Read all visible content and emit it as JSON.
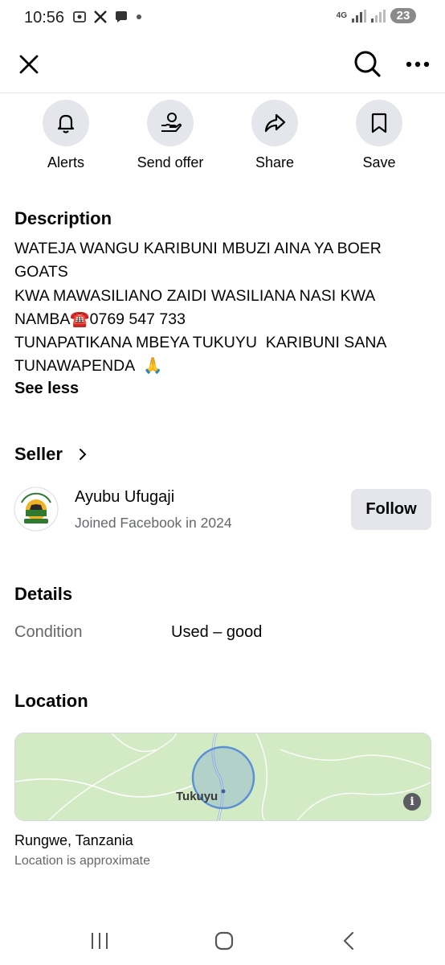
{
  "status_bar": {
    "time": "10:56",
    "network": "4G",
    "battery": "23",
    "icons": [
      "screenshot-icon",
      "x-app-icon",
      "chat-icon",
      "dot-icon"
    ]
  },
  "top_bar": {
    "icons": [
      "close-icon",
      "search-icon",
      "more-icon"
    ]
  },
  "actions": [
    {
      "label": "Alerts",
      "icon": "bell-icon"
    },
    {
      "label": "Send offer",
      "icon": "hand-money-icon"
    },
    {
      "label": "Share",
      "icon": "share-arrow-icon"
    },
    {
      "label": "Save",
      "icon": "bookmark-icon"
    }
  ],
  "description": {
    "title": "Description",
    "text": "WATEJA WANGU KARIBUNI MBUZI AINA YA BOER GOATS\nKWA MAWASILIANO ZAIDI WASILIANA NASI KWA NAMBA☎️0769 547 733\nTUNAPATIKANA MBEYA TUKUYU  KARIBUNI SANA TUNAWAPENDA  🙏",
    "toggle": "See less"
  },
  "seller": {
    "title": "Seller",
    "name": "Ayubu Ufugaji",
    "joined": "Joined Facebook in 2024",
    "follow_label": "Follow",
    "avatar_text_top": "AYUBU UFUGAJI",
    "avatar_text_bottom": "FARM ANIMALS"
  },
  "details": {
    "title": "Details",
    "rows": [
      {
        "label": "Condition",
        "value": "Used – good"
      }
    ]
  },
  "location": {
    "title": "Location",
    "map_label": "Tukuyu",
    "place": "Rungwe, Tanzania",
    "note": "Location is approximate"
  },
  "colors": {
    "button_bg": "#e4e6eb",
    "secondary_text": "#65676b",
    "map_green": "#d3ebc4",
    "map_circle": "#5b8fd6"
  },
  "nav_bar": {
    "icons": [
      "recent-apps-icon",
      "home-icon",
      "back-icon"
    ]
  }
}
